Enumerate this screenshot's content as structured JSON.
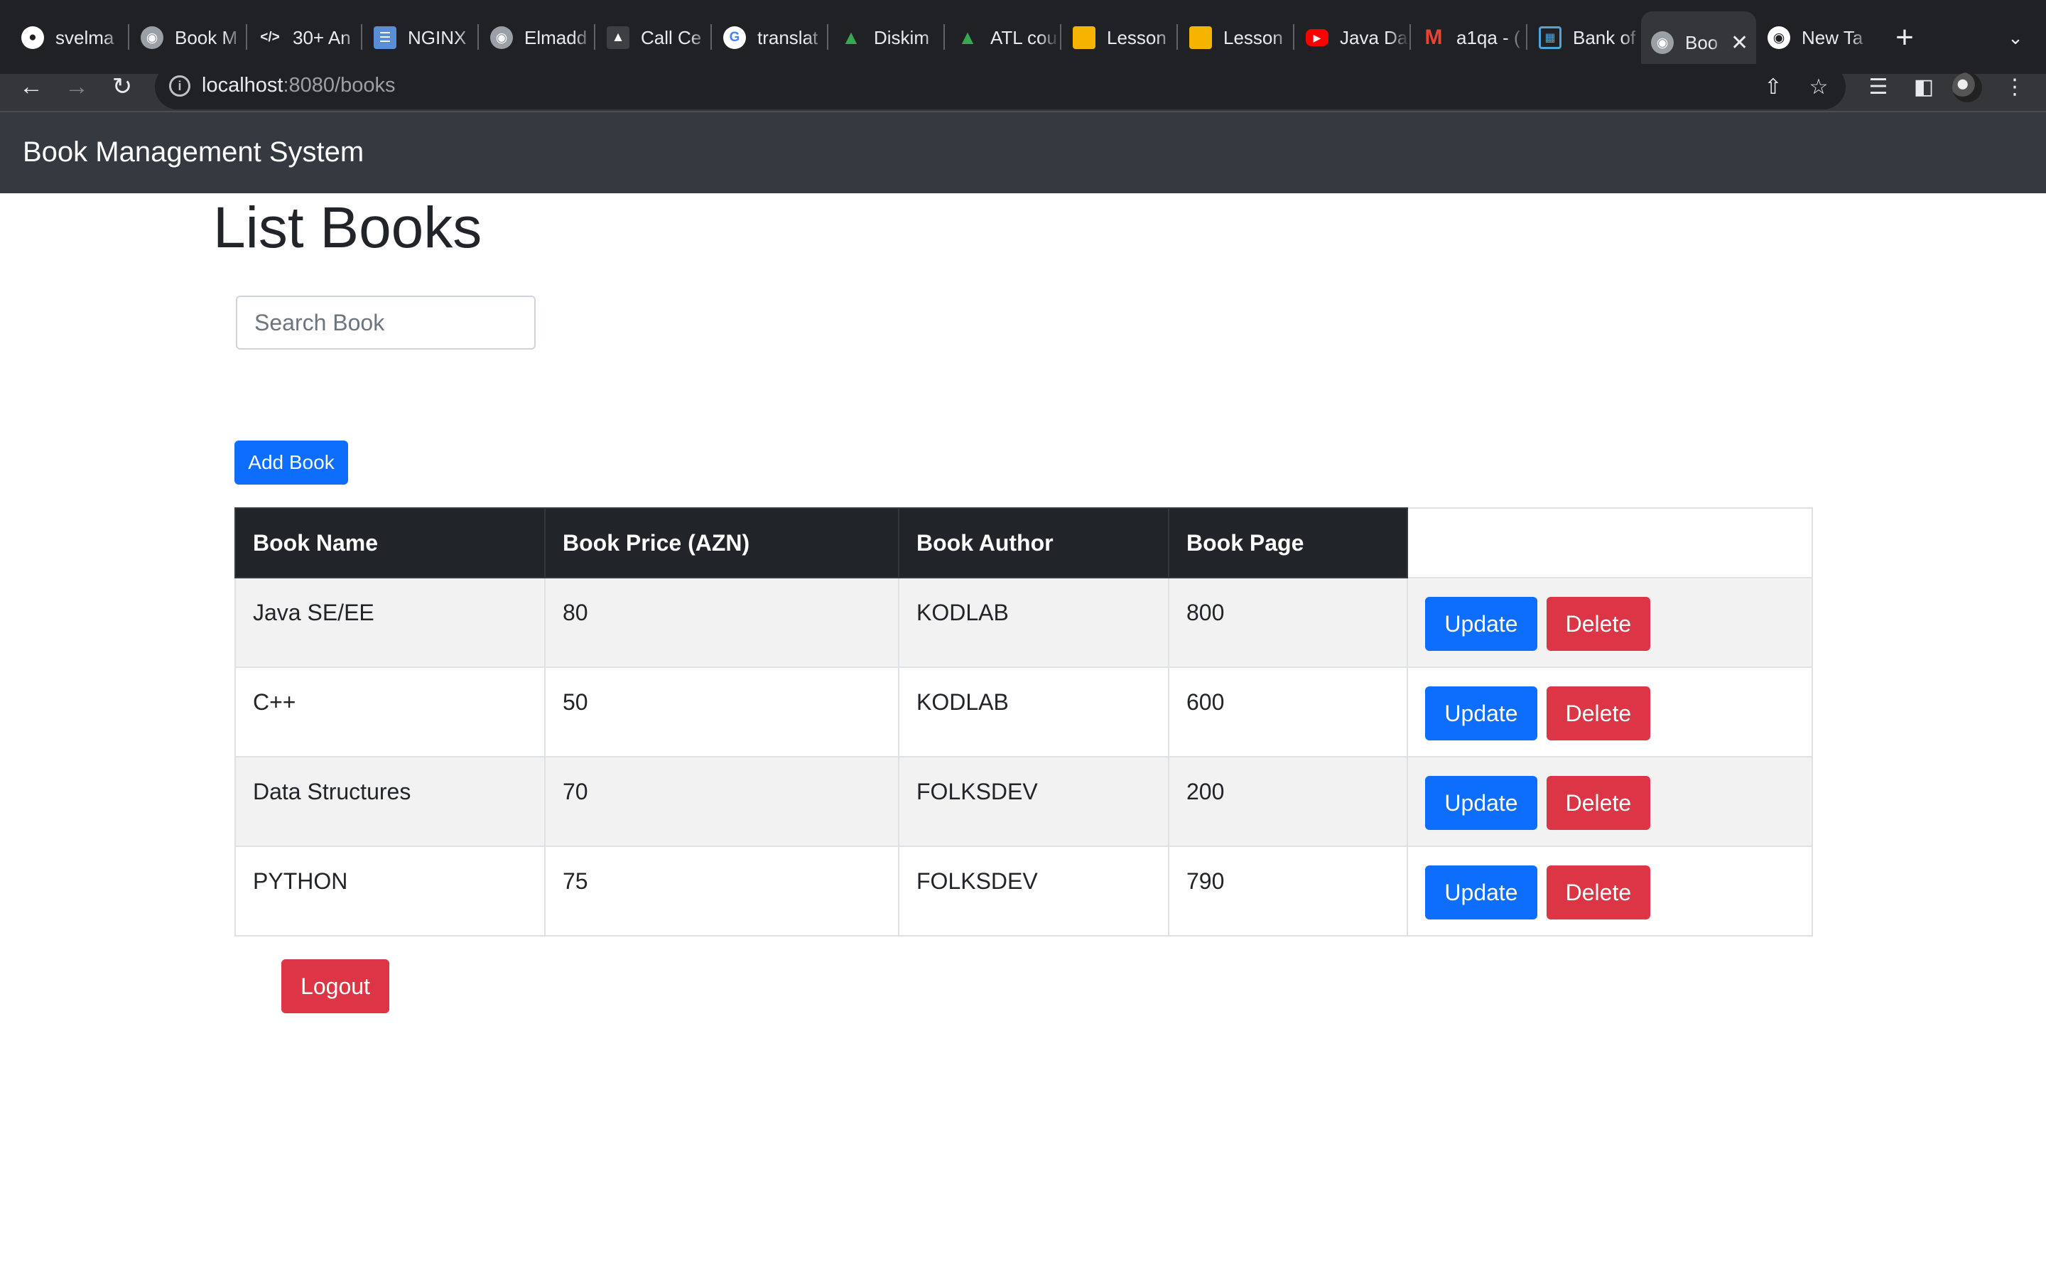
{
  "browser": {
    "tabs": [
      {
        "label": "svelma",
        "icon": "github-icon",
        "color": "#ffffff"
      },
      {
        "label": "Book M",
        "icon": "globe-icon",
        "color": "#9aa0a6"
      },
      {
        "label": "30+ An",
        "icon": "code-icon",
        "color": "#202124"
      },
      {
        "label": "NGINX",
        "icon": "layers-icon",
        "color": "#5b8dd6"
      },
      {
        "label": "Elmadd",
        "icon": "globe-icon",
        "color": "#9aa0a6"
      },
      {
        "label": "Call Ce",
        "icon": "graduation-cap-icon",
        "color": "#3c4043"
      },
      {
        "label": "translat",
        "icon": "google-icon",
        "color": "#ffffff"
      },
      {
        "label": "Diskim",
        "icon": "google-drive-icon",
        "color": "#34a853"
      },
      {
        "label": "ATL cou",
        "icon": "google-drive-icon",
        "color": "#34a853"
      },
      {
        "label": "Lesson",
        "icon": "slides-icon",
        "color": "#f4b400"
      },
      {
        "label": "Lesson",
        "icon": "slides-icon",
        "color": "#f4b400"
      },
      {
        "label": "Java Da",
        "icon": "youtube-icon",
        "color": "#ff0000"
      },
      {
        "label": "a1qa - (",
        "icon": "gmail-icon",
        "color": "#ea4335"
      },
      {
        "label": "Bank of",
        "icon": "bank-icon",
        "color": "#4fa3d9"
      },
      {
        "label": "Boo",
        "icon": "globe-icon",
        "color": "#9aa0a6",
        "active": true
      },
      {
        "label": "New Ta",
        "icon": "chrome-icon",
        "color": "#ffffff"
      }
    ],
    "url_host": "localhost",
    "url_rest": ":8080/books"
  },
  "navbar": {
    "brand": "Book Management System"
  },
  "page": {
    "title": "List Books",
    "search_placeholder": "Search Book",
    "add_button": "Add Book",
    "logout_button": "Logout"
  },
  "table": {
    "headers": [
      "Book Name",
      "Book Price (AZN)",
      "Book Author",
      "Book Page"
    ],
    "rows": [
      {
        "name": "Java SE/EE",
        "price": "80",
        "author": "KODLAB",
        "pages": "800"
      },
      {
        "name": "C++",
        "price": "50",
        "author": "KODLAB",
        "pages": "600"
      },
      {
        "name": "Data Structures",
        "price": "70",
        "author": "FOLKSDEV",
        "pages": "200"
      },
      {
        "name": "PYTHON",
        "price": "75",
        "author": "FOLKSDEV",
        "pages": "790"
      }
    ],
    "update_label": "Update",
    "delete_label": "Delete"
  },
  "colors": {
    "primary": "#0d6efd",
    "danger": "#dc3545",
    "navbar": "#343a40",
    "table_header": "#212529"
  }
}
